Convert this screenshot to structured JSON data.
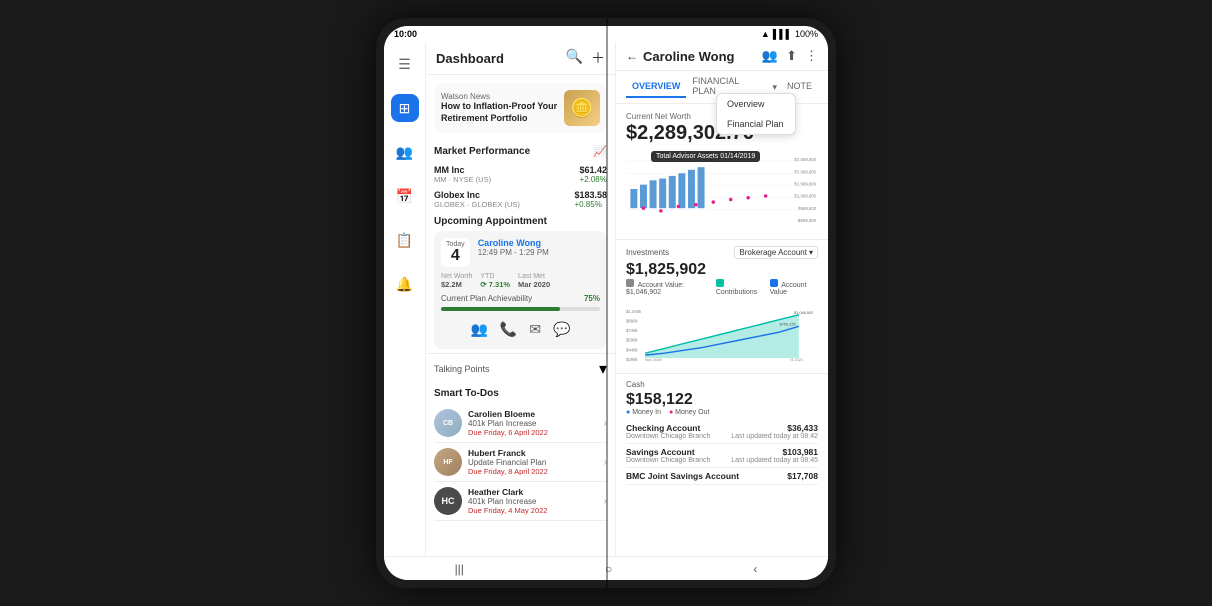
{
  "status_bar": {
    "time": "10:00",
    "battery": "100%",
    "signal": "WiFi"
  },
  "header": {
    "title": "Dashboard",
    "search_label": "🔍",
    "add_label": "+"
  },
  "news": {
    "source": "Watson News",
    "title": "How to Inflation-Proof Your Retirement Portfolio"
  },
  "market": {
    "title": "Market Performance",
    "items": [
      {
        "name": "MM Inc",
        "sub": "MM · NYSE (US)",
        "price": "$61.42",
        "change": "+2.08%",
        "positive": true
      },
      {
        "name": "Globex Inc",
        "sub": "GLOBEX · GLOBEX (US)",
        "price": "$183.58",
        "change": "+0.85%",
        "positive": true
      }
    ]
  },
  "appointment": {
    "title": "Upcoming Appointment",
    "today_label": "Today",
    "day": "4",
    "client_name": "Caroline Wong",
    "time": "12:49 PM - 1:29 PM",
    "net_worth_label": "Net Worth",
    "net_worth": "$2.2M",
    "ytd_label": "YTD",
    "ytd_value": "7.31%",
    "last_met_label": "Last Met",
    "last_met_value": "Mar 2020",
    "plan_label": "Current Plan Achievability",
    "plan_pct": "75%",
    "plan_pct_num": 75
  },
  "talking_points": {
    "label": "Talking Points",
    "expand_icon": "▾"
  },
  "smart_todos": {
    "title": "Smart To-Dos",
    "items": [
      {
        "name": "Carolien Bloeme",
        "task": "401k Plan Increase",
        "due": "Due Friday, 6 April 2022",
        "avatar_type": "image1"
      },
      {
        "name": "Hubert Franck",
        "task": "Update Financial Plan",
        "due": "Due Friday, 8 April 2022",
        "avatar_type": "image2"
      },
      {
        "name": "Heather Clark",
        "task": "401k Plan Increase",
        "due": "Due Friday, 4 May 2022",
        "avatar_type": "initials",
        "initials": "HC"
      }
    ]
  },
  "client": {
    "name": "Caroline Wong",
    "back_icon": "←",
    "tabs": [
      "OVERVIEW",
      "FINANCIAL PLAN",
      "NOTE"
    ],
    "active_tab": "OVERVIEW",
    "dropdown_items": [
      "Overview",
      "Financial Plan"
    ],
    "net_worth_label": "Current Net Worth",
    "net_worth": "$2,289,302.76",
    "tooltip": "Total Advisor Assets 01/14/2019",
    "chart_y_labels": [
      "$2,589,800",
      "$2,089,800",
      "$1,589,800",
      "$1,089,800",
      "$589,800",
      "-$589,800"
    ],
    "investments_label": "Investments",
    "investments_value": "$1,825,902",
    "investments_dropdown": "Brokerage Account",
    "investments_account_label": "Account Value:",
    "investments_account_value": "$1,046,902",
    "legend_contributions": "Contributions",
    "legend_account_value": "Account Value",
    "cash_label": "Cash",
    "cash_value": "$158,122",
    "cash_money_in": "Money In",
    "cash_money_out": "Money Out",
    "accounts": [
      {
        "name": "Checking Account",
        "sub": "Downtown Chicago Branch",
        "value": "$36,433",
        "updated": "Last updated today at 08:42"
      },
      {
        "name": "Savings Account",
        "sub": "Downtown Chicago Branch",
        "value": "$103,981",
        "updated": "Last updated today at 08:45"
      },
      {
        "name": "BMC Joint Savings Account",
        "sub": "",
        "value": "$17,708",
        "updated": ""
      }
    ]
  }
}
